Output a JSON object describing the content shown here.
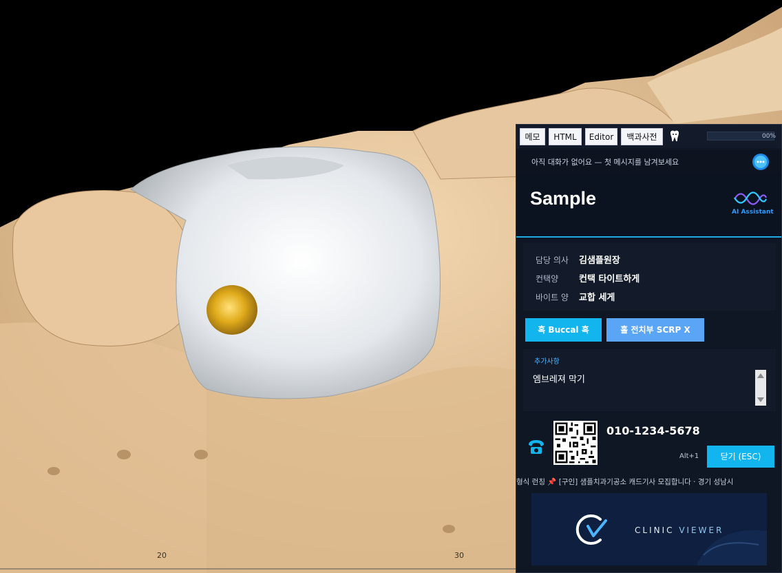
{
  "tabs": [
    {
      "label": "메모"
    },
    {
      "label": "HTML"
    },
    {
      "label": "Editor"
    },
    {
      "label": "백과사전"
    }
  ],
  "progress": {
    "text": "00%",
    "value": 0
  },
  "message_bar": {
    "text": "아직 대화가 없어요 — 첫 메시지를 남겨보세요"
  },
  "header": {
    "title": "Sample",
    "ai_label": "AI Assistant"
  },
  "info": [
    {
      "label": "담당 의사",
      "value": "김샘플원장"
    },
    {
      "label": "컨택양",
      "value": "컨택 타이트하게"
    },
    {
      "label": "바이트 양",
      "value": "교합 세게"
    }
  ],
  "buttons": {
    "buccal": "혹  Buccal 혹",
    "scrp": "홀  전치부 SCRP X"
  },
  "notes": {
    "label": "추가사항",
    "text": "엠브레져 막기"
  },
  "contact": {
    "phone": "010-1234-5678",
    "shortcut": "Alt+1",
    "close_label": "닫기 (ESC)"
  },
  "ticker": {
    "text": "형식 런칭     📌 [구인] 샘플치과기공소 캐드기사 모집합니다 · 경기 성남시"
  },
  "banner": {
    "brand_a": "CLINIC ",
    "brand_b": "VIEWER"
  },
  "viewport": {
    "ruler_labels": [
      "20",
      "30"
    ]
  },
  "colors": {
    "accent": "#12b5ee",
    "accent_alt": "#5aa5f5",
    "panel_bg": "#0f1624",
    "model_tan": "#e8c79c",
    "crown_white": "#e9edf0",
    "marker_gold": "#d9a617"
  }
}
